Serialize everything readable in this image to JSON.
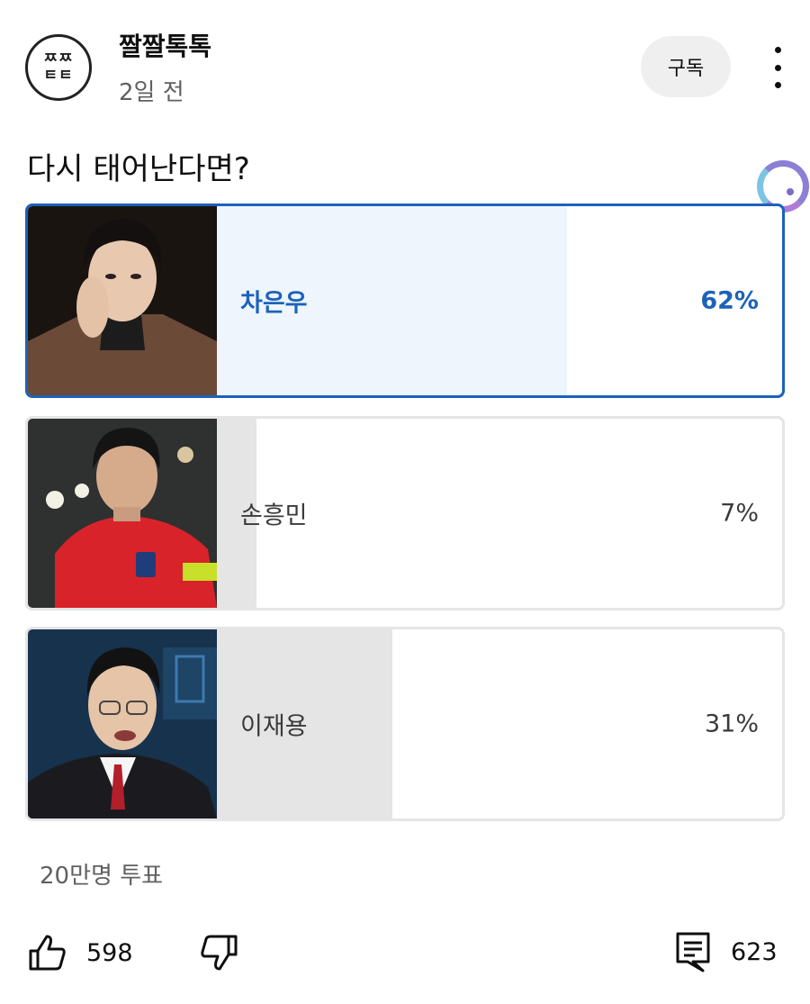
{
  "channel": {
    "avatar_lines": [
      "ㅉㅉ",
      "ㅌㅌ"
    ],
    "name": "짤짤톡톡",
    "posted": "2일 전",
    "subscribe_label": "구독"
  },
  "poll": {
    "question": "다시 태어난다면?",
    "options": [
      {
        "label": "차은우",
        "percent_text": "62%",
        "percent": 62,
        "selected": true
      },
      {
        "label": "손흥민",
        "percent_text": "7%",
        "percent": 7,
        "selected": false
      },
      {
        "label": "이재용",
        "percent_text": "31%",
        "percent": 31,
        "selected": false
      }
    ],
    "vote_count": "20만명 투표"
  },
  "actions": {
    "likes": "598",
    "comments": "623"
  },
  "colors": {
    "selected_accent": "#1c62b9",
    "selected_fill": "#eef5fd",
    "unselected_fill": "#e5e5e5"
  }
}
